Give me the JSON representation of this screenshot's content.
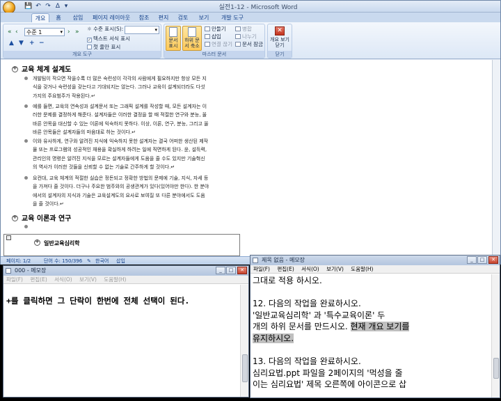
{
  "word": {
    "title": "실전1-12 - Microsoft Word",
    "quick_access": [
      "💾",
      "↶",
      "↷",
      "ᐃ",
      "▾"
    ],
    "tabs": [
      "개요",
      "홈",
      "삽입",
      "페이지 레이아웃",
      "참조",
      "편지",
      "검토",
      "보기",
      "개발 도구"
    ],
    "active_tab": "개요",
    "ribbon": {
      "outline_tools": {
        "label": "개요 도구",
        "level_value": "수준 1",
        "show_level_label": "수준 표시(S):",
        "show_text_format_label": "텍스트 서식 표시",
        "show_text_format_checked": true,
        "first_line_only_label": "첫 줄만 표시",
        "first_line_only_checked": false
      },
      "master_doc": {
        "label": "마스터 문서",
        "show_document_label": "문서 표시",
        "collapse_subdocs_label": "하위 문서 축소",
        "create_label": "만들기",
        "insert_label": "삽입",
        "unlink_label": "연결 끊기",
        "merge_label": "병합",
        "split_label": "나누기",
        "lock_label": "문서 잠금"
      },
      "close": {
        "label": "닫기",
        "close_outline_label": "개요 보기 닫기"
      }
    },
    "document": {
      "heading1": "교육 체계 설계도",
      "paragraphs": [
        {
          "lines": [
            "개발팀이 작으면 작을수록 더 많은 숙련성이 각각의 사람에게 필요하지만 항상 모든 지",
            "식을 갖거나 숙련성을 갖는다고 기대되지는 않는다. 그러나 교육이 설계되더라도 다섯",
            "가지의 주요범주가 작용된다.↵"
          ]
        },
        {
          "lines": [
            "예를 들면, 교육의 연속성과 설계문서 또는 그래픽 설계를 작성할 때, 모든 설계자는 이",
            "러한 문제를 결정하게 해준다. 설계자들은 이러한 결정을 할 때 적절한 연구와 분능, 올",
            "바른 안목을 대신할 수 있는 이론에 익숙하지 못하다. 이상, 이론, 연구, 분능, 그리고 올",
            "바른 안목들은 설계자들의 마음대로 하는 것이다.↵"
          ]
        },
        {
          "lines": [
            "이와 유사하게, 연구와 알려진 지식에 익숙하지 못한 설계자는 결국 어떠한 생산된 제작",
            "물 또는 프로그램의 성공적인 채용을 확실하게 하려는 일에 직면하게 된다. 윤, 설득력,",
            "관리인의 명령은 알려진 지식을 모르는 설계자들에게 도움을 줄 수도 있지만 기술혁신",
            "의 역사가 이러한 것들을 신뢰할 수 없는 기술로 간주하게 할 것이다.↵"
          ]
        },
        {
          "lines": [
            "요컨대, 교육 체계의 적절한 실습은 정돈되고 정확한 방법의 문제에 기술, 지식, 자세 등",
            "을 가져다 줄 것이다. 더구나 주요한 범주와의 공생관계가 있다(있어야만 한다). 한 분야",
            "에서의 설계자의 지식과 기술은 교육설계도의 요사로 보여질 또 다른 분야에서도 도움",
            "을 줄 것이다.↵"
          ]
        }
      ],
      "heading2": "교육 이론과 연구",
      "empty_mark": "↵",
      "subdoc_heading": "일반교육심리학"
    },
    "status": {
      "page": "페이지: 1/2",
      "words": "단어 수: 150/396",
      "language": "한국어",
      "mode": "삽입"
    }
  },
  "notepad_left": {
    "title": "000 - 메모장",
    "menu": [
      "파일(F)",
      "편집(E)",
      "서식(O)",
      "보기(V)",
      "도움말(H)"
    ],
    "content": "+를 클릭하면 그 단락이 한번에 전체 선택이 된다."
  },
  "notepad_right": {
    "title": "제목 없음 - 메모장",
    "menu": [
      "파일(F)",
      "편집(E)",
      "서식(O)",
      "보기(V)",
      "도움말(H)"
    ],
    "lines": [
      {
        "text": "  그대로 적용 하시오.",
        "sel": ""
      },
      {
        "text": "",
        "sel": ""
      },
      {
        "text": "12. 다음의 작업을 완료하시오.",
        "sel": ""
      },
      {
        "text": "   '일반교육심리학'  과  '특수교육이론'  두",
        "sel": ""
      },
      {
        "text": "개의 하위 문서를 만드시오. ",
        "sel": "현재 개요 보기를"
      },
      {
        "text": "",
        "sel": "유지하시오."
      },
      {
        "text": "",
        "sel": ""
      },
      {
        "text": "13. 다음의 작업을 완료하시오.",
        "sel": ""
      },
      {
        "text": "   심리요법.ppt 파일을 2페이지의  '먹성을 줄",
        "sel": ""
      },
      {
        "text": "이는 심리요법'  제목 오른쪽에 아이콘으로 삽",
        "sel": ""
      }
    ]
  }
}
